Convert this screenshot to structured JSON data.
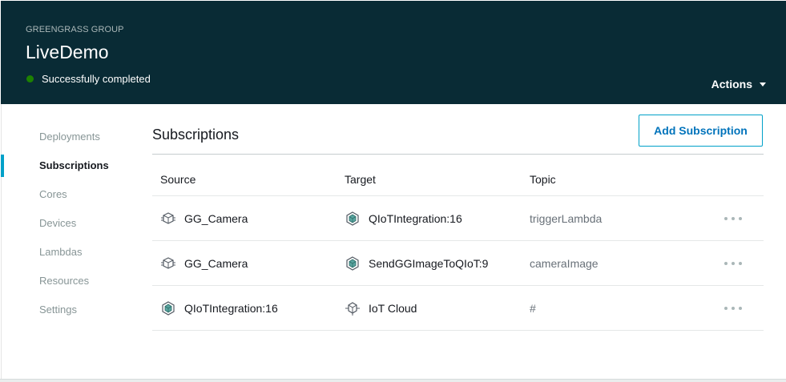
{
  "header": {
    "group_label": "GREENGRASS GROUP",
    "group_name": "LiveDemo",
    "status_text": "Successfully completed",
    "actions_label": "Actions"
  },
  "sidebar": {
    "items": [
      {
        "label": "Deployments",
        "active": false
      },
      {
        "label": "Subscriptions",
        "active": true
      },
      {
        "label": "Cores",
        "active": false
      },
      {
        "label": "Devices",
        "active": false
      },
      {
        "label": "Lambdas",
        "active": false
      },
      {
        "label": "Resources",
        "active": false
      },
      {
        "label": "Settings",
        "active": false
      }
    ]
  },
  "main": {
    "title": "Subscriptions",
    "add_button_label": "Add Subscription",
    "columns": {
      "source": "Source",
      "target": "Target",
      "topic": "Topic"
    },
    "rows": [
      {
        "source": "GG_Camera",
        "source_icon": "device-icon",
        "target": "QIoTIntegration:16",
        "target_icon": "lambda-cube-icon",
        "topic": "triggerLambda"
      },
      {
        "source": "GG_Camera",
        "source_icon": "device-icon",
        "target": "SendGGImageToQIoT:9",
        "target_icon": "lambda-cube-icon",
        "topic": "cameraImage"
      },
      {
        "source": "QIoTIntegration:16",
        "source_icon": "lambda-cube-icon",
        "target": "IoT Cloud",
        "target_icon": "cloud-icon",
        "topic": "#"
      }
    ]
  },
  "colors": {
    "header_bg": "#092b35",
    "status_success": "#1d8102",
    "accent": "#00a1c9",
    "link": "#0073bb"
  }
}
